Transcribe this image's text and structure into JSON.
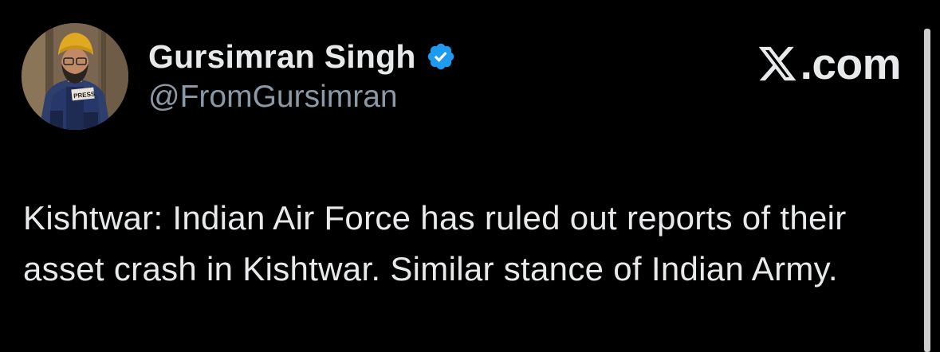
{
  "author": {
    "display_name": "Gursimran Singh",
    "handle": "@FromGursimran",
    "verified": true,
    "avatar_vest_text": "PRESS"
  },
  "brand": {
    "site": ".com",
    "logo_icon": "x-logo-icon"
  },
  "tweet": {
    "text": "Kishtwar: Indian Air Force has ruled out reports of their asset crash in Kishtwar. Similar stance of Indian Army."
  },
  "colors": {
    "background": "#000000",
    "text_primary": "#e7e9ea",
    "text_secondary": "#8b98a5",
    "verified_blue": "#1d9bf0"
  }
}
